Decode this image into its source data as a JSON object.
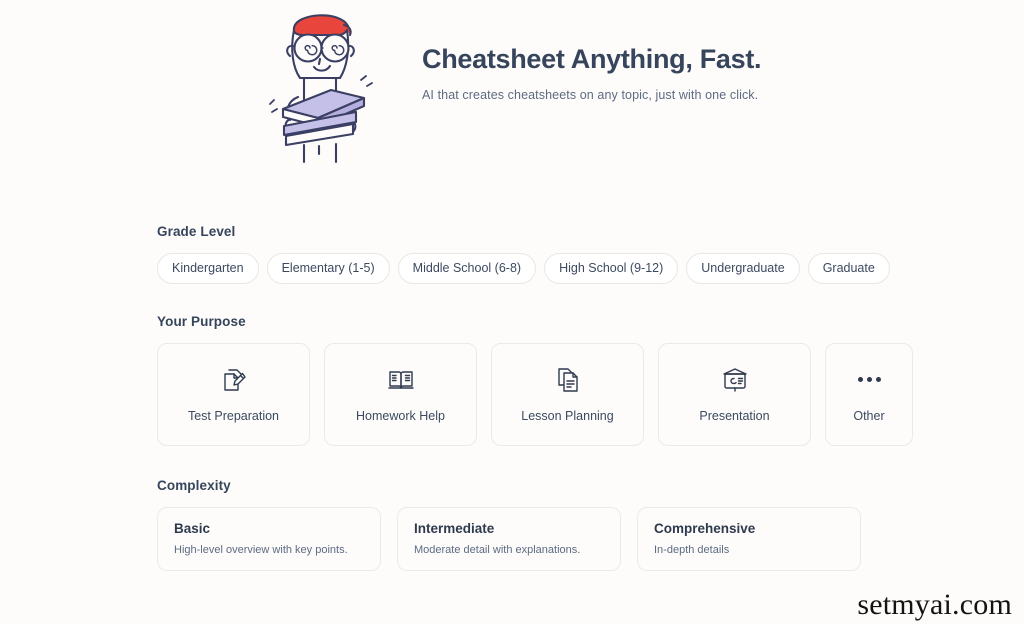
{
  "hero": {
    "title": "Cheatsheet Anything, Fast.",
    "subtitle": "AI that creates cheatsheets on any topic, just with one click.",
    "illustration_name": "student-holding-books-illustration",
    "colors": {
      "cap": "#e8453c",
      "books": "#c5c0e8",
      "outline": "#3b3f63"
    }
  },
  "grade_level": {
    "title": "Grade Level",
    "options": [
      {
        "label": "Kindergarten"
      },
      {
        "label": "Elementary (1-5)"
      },
      {
        "label": "Middle School (6-8)"
      },
      {
        "label": "High School (9-12)"
      },
      {
        "label": "Undergraduate"
      },
      {
        "label": "Graduate"
      }
    ]
  },
  "purpose": {
    "title": "Your Purpose",
    "options": [
      {
        "label": "Test Preparation",
        "icon": "document-pencil-icon"
      },
      {
        "label": "Homework Help",
        "icon": "open-book-icon"
      },
      {
        "label": "Lesson Planning",
        "icon": "copy-documents-icon"
      },
      {
        "label": "Presentation",
        "icon": "presentation-board-icon"
      },
      {
        "label": "Other",
        "icon": "ellipsis-icon"
      }
    ]
  },
  "complexity": {
    "title": "Complexity",
    "options": [
      {
        "name": "Basic",
        "desc": "High-level overview with key points."
      },
      {
        "name": "Intermediate",
        "desc": "Moderate detail with explanations."
      },
      {
        "name": "Comprehensive",
        "desc": "In-depth details"
      }
    ]
  },
  "watermark": {
    "text": "setmyai.com"
  },
  "theme": {
    "background": "#fdfcfa",
    "heading": "#36455c",
    "body_text": "#5d6b82",
    "border": "#eceae5"
  }
}
